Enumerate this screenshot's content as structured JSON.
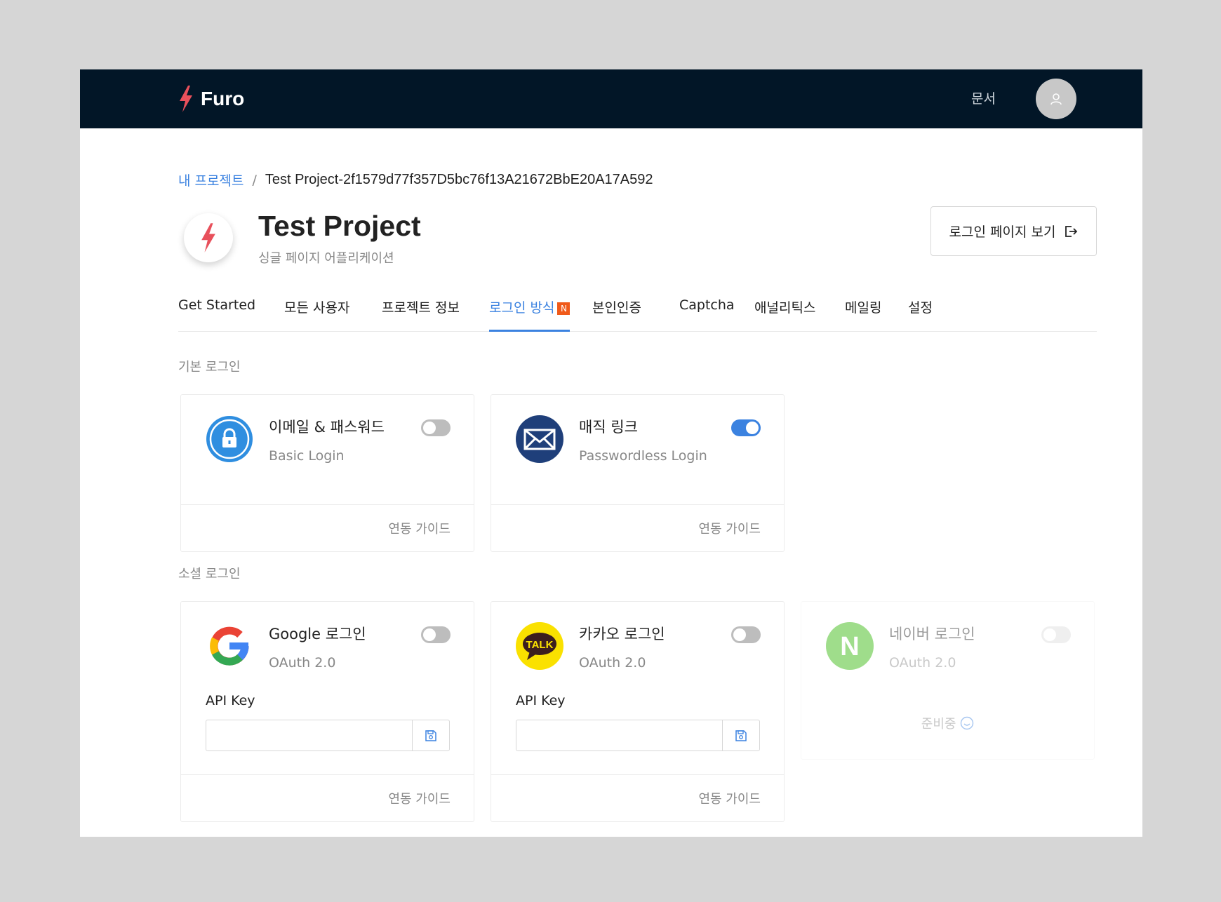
{
  "app": {
    "name": "Furo"
  },
  "header": {
    "docs_label": "문서"
  },
  "breadcrumb": {
    "root": "내 프로젝트",
    "separator": "/",
    "current": "Test Project-2f1579d77f357D5bc76f13A21672BbE20A17A592"
  },
  "project": {
    "title": "Test Project",
    "subtitle": "싱글 페이지 어플리케이션",
    "view_login_label": "로그인 페이지 보기"
  },
  "tabs": [
    {
      "label": "Get Started"
    },
    {
      "label": "모든 사용자"
    },
    {
      "label": "프로젝트 정보"
    },
    {
      "label": "로그인 방식",
      "badge": "N",
      "active": true
    },
    {
      "label": "본인인증"
    },
    {
      "label": "Captcha"
    },
    {
      "label": "애널리틱스"
    },
    {
      "label": "메일링"
    },
    {
      "label": "설정"
    }
  ],
  "sections": {
    "basic": "기본 로그인",
    "social": "소셜 로그인"
  },
  "basic_cards": [
    {
      "title": "이메일 & 패스워드",
      "subtitle": "Basic Login",
      "enabled": false,
      "guide": "연동 가이드",
      "icon": "lock-icon"
    },
    {
      "title": "매직 링크",
      "subtitle": "Passwordless Login",
      "enabled": true,
      "guide": "연동 가이드",
      "icon": "mail-icon"
    }
  ],
  "social_cards": [
    {
      "title": "Google 로그인",
      "subtitle": "OAuth 2.0",
      "enabled": false,
      "api_label": "API Key",
      "api_value": "",
      "guide": "연동 가이드",
      "icon": "google-icon"
    },
    {
      "title": "카카오 로그인",
      "subtitle": "OAuth 2.0",
      "enabled": false,
      "api_label": "API Key",
      "api_value": "",
      "guide": "연동 가이드",
      "icon": "kakao-talk-icon",
      "icon_text": "TALK"
    },
    {
      "title": "네이버 로그인",
      "subtitle": "OAuth 2.0",
      "enabled": false,
      "status": "준비중",
      "icon": "naver-icon",
      "icon_text": "N"
    }
  ],
  "colors": {
    "topbar": "#021627",
    "accent": "#3b82e0",
    "brand": "#e8505b",
    "new_badge": "#f05a1a",
    "kakao": "#fae100",
    "naver": "#2db400"
  }
}
